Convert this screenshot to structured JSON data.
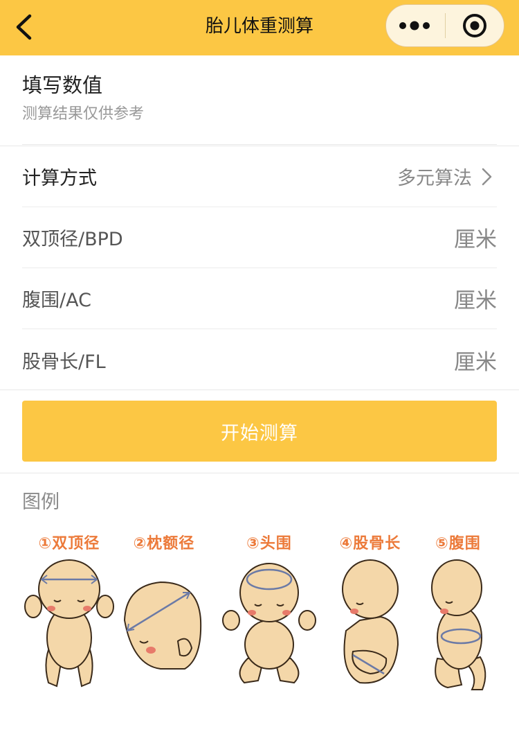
{
  "nav": {
    "title": "胎儿体重测算"
  },
  "header": {
    "title": "填写数值",
    "subtitle": "测算结果仅供参考"
  },
  "form": {
    "method": {
      "label": "计算方式",
      "value": "多元算法"
    },
    "fields": [
      {
        "label": "双顶径/BPD",
        "unit": "厘米",
        "value": ""
      },
      {
        "label": "腹围/AC",
        "unit": "厘米",
        "value": ""
      },
      {
        "label": "股骨长/FL",
        "unit": "厘米",
        "value": ""
      }
    ]
  },
  "submit_label": "开始测算",
  "legend": {
    "title": "图例",
    "items": [
      {
        "caption": "①双顶径"
      },
      {
        "caption": "②枕额径"
      },
      {
        "caption": "③头围"
      },
      {
        "caption": "④股骨长"
      },
      {
        "caption": "⑤腹围"
      }
    ]
  },
  "colors": {
    "brand_yellow": "#fcc744",
    "caption_orange": "#ec7a3a",
    "skin": "#f4d7a9",
    "measure_line": "#6b7aa6"
  },
  "icons": {
    "back": "chevron-left",
    "more": "three-dots",
    "close": "target-circle",
    "row_arrow": "chevron-right"
  }
}
